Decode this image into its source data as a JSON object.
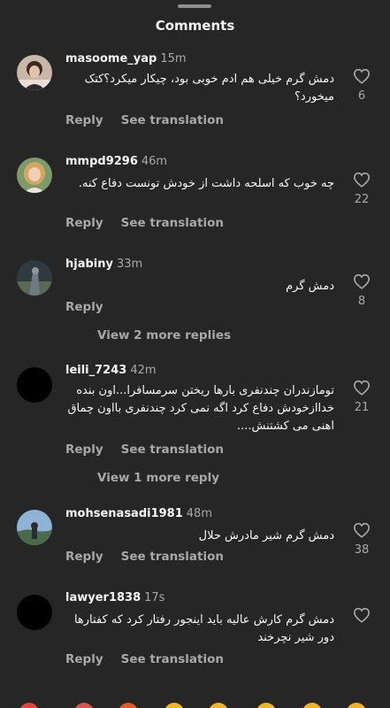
{
  "header": {
    "title": "Comments"
  },
  "comments": [
    {
      "username": "masoome_yap",
      "time": "15m",
      "text": "دمش گرم خیلی هم ادم خوبی بود، چیکار میکرد؟کتک میخورد؟",
      "likes": "6",
      "reply_label": "Reply",
      "translate_label": "See translation"
    },
    {
      "username": "mmpd9296",
      "time": "46m",
      "text": "چه خوب که اسلحه داشت از خودش تونست دفاع کنه.",
      "likes": "22",
      "reply_label": "Reply",
      "translate_label": "See translation"
    },
    {
      "username": "hjabiny",
      "time": "33m",
      "text": "دمش گرم",
      "likes": "8",
      "reply_label": "Reply",
      "view_replies": "View 2 more replies"
    },
    {
      "username": "leili_7243",
      "time": "42m",
      "text": "تومازندران چندنفری بارها ریختن سرمسافرا...اون بنده خداازخودش دفاع کرد اگه نمی کرد چندنفری بااون چماق اهنی می کشتنش....",
      "likes": "21",
      "reply_label": "Reply",
      "translate_label": "See translation",
      "view_replies": "View 1 more reply"
    },
    {
      "username": "mohsenasadi1981",
      "time": "48m",
      "text": "دمش گرم شیر مادرش حلال",
      "likes": "38",
      "reply_label": "Reply",
      "translate_label": "See translation"
    },
    {
      "username": "lawyer1838",
      "time": "17s",
      "text": "دمش گرم کارش عالیه باید اینجور رفتار کرد که کفتارها دور شیر نچرخند",
      "likes": "",
      "reply_label": "Reply",
      "translate_label": "See translation"
    }
  ],
  "colors": {
    "background": "#262626",
    "primary_text": "#f5f5f5",
    "secondary_text": "#a8a8a8"
  }
}
